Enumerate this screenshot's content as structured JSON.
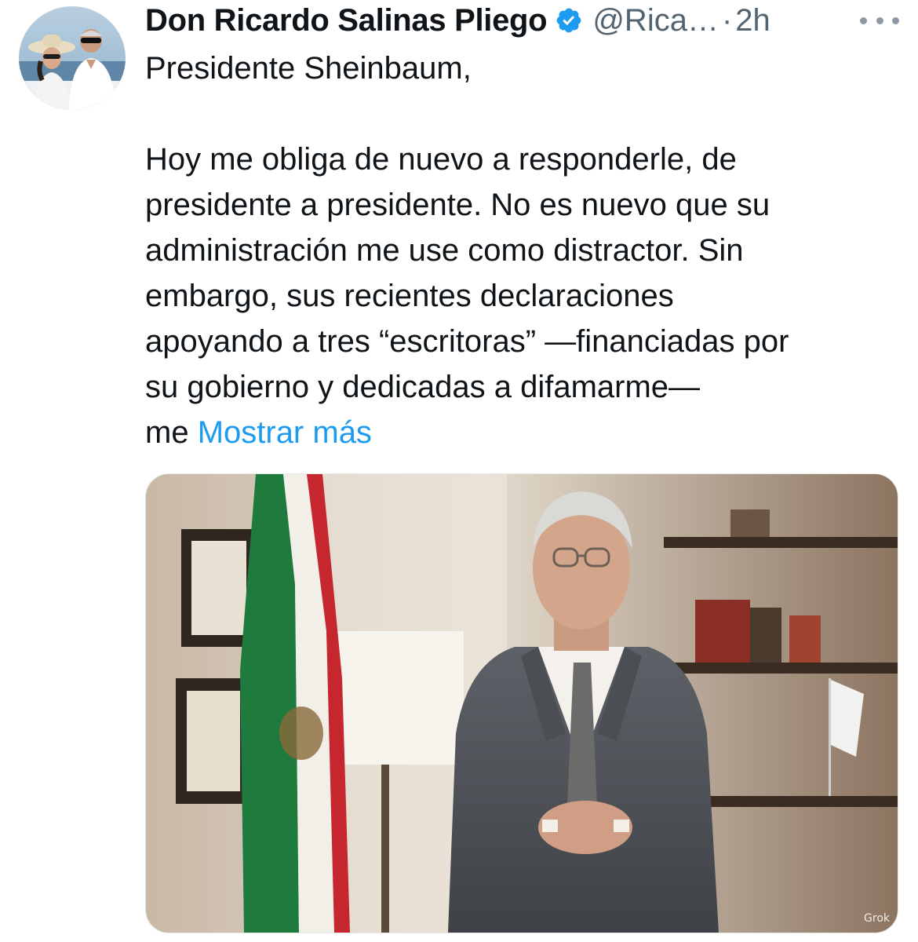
{
  "tweet": {
    "author": {
      "name": "Don Ricardo Salinas Pliego",
      "handle": "@Rica…",
      "verified": true,
      "avatar_icon": "profile-photo-avatar"
    },
    "separator": "·",
    "time": "2h",
    "more_icon": "more-horizontal-icon",
    "salutation": "Presidente Sheinbaum,",
    "paragraph": "Hoy me obliga de nuevo a responderle, de\npresidente a presidente. No es nuevo que su\nadministración me use como distractor. Sin\nembargo, sus recientes declaraciones\napoyando a tres “escritoras” —financiadas por\nsu gobierno y dedicadas a difamarme—\nme ",
    "show_more": "Mostrar más",
    "media": {
      "icon": "attached-photo-image",
      "watermark": "Grok"
    }
  },
  "colors": {
    "text": "#0f1419",
    "secondary": "#536471",
    "link": "#1d9bf0",
    "verified": "#1d9bf0"
  }
}
